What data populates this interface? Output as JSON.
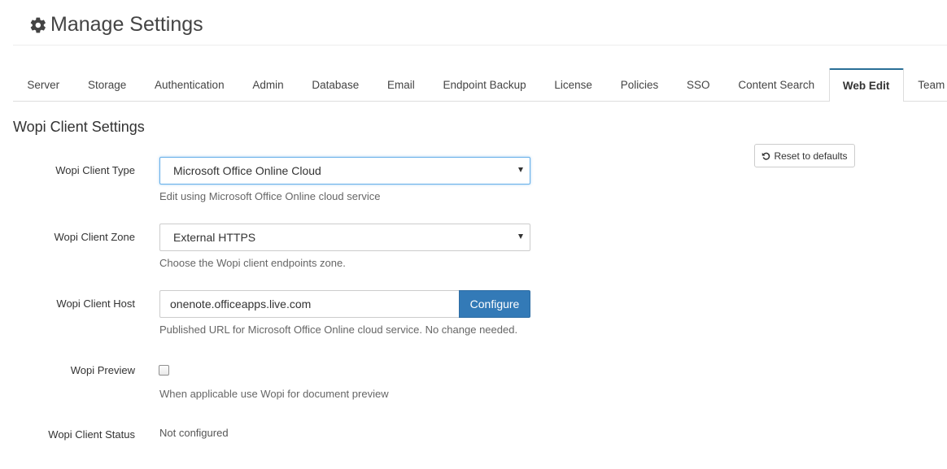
{
  "header": {
    "title": "Manage Settings",
    "icon": "gear-icon"
  },
  "tabs": [
    {
      "label": "Server",
      "active": false
    },
    {
      "label": "Storage",
      "active": false
    },
    {
      "label": "Authentication",
      "active": false
    },
    {
      "label": "Admin",
      "active": false
    },
    {
      "label": "Database",
      "active": false
    },
    {
      "label": "Email",
      "active": false
    },
    {
      "label": "Endpoint Backup",
      "active": false
    },
    {
      "label": "License",
      "active": false
    },
    {
      "label": "Policies",
      "active": false
    },
    {
      "label": "SSO",
      "active": false
    },
    {
      "label": "Content Search",
      "active": false
    },
    {
      "label": "Web Edit",
      "active": true
    },
    {
      "label": "Team Folders",
      "active": false
    }
  ],
  "section": {
    "title": "Wopi Client Settings",
    "reset_label": "Reset to defaults"
  },
  "fields": {
    "client_type": {
      "label": "Wopi Client Type",
      "value": "Microsoft Office Online Cloud",
      "help": "Edit using Microsoft Office Online cloud service"
    },
    "client_zone": {
      "label": "Wopi Client Zone",
      "value": "External HTTPS",
      "help": "Choose the Wopi client endpoints zone."
    },
    "client_host": {
      "label": "Wopi Client Host",
      "value": "onenote.officeapps.live.com",
      "button": "Configure",
      "help": "Published URL for Microsoft Office Online cloud service. No change needed."
    },
    "preview": {
      "label": "Wopi Preview",
      "checked": false,
      "help": "When applicable use Wopi for document preview"
    },
    "status": {
      "label": "Wopi Client Status",
      "value": "Not configured"
    }
  },
  "colors": {
    "primary": "#337ab7",
    "active_tab_border": "#2a6f96",
    "focus": "#66afe9"
  }
}
